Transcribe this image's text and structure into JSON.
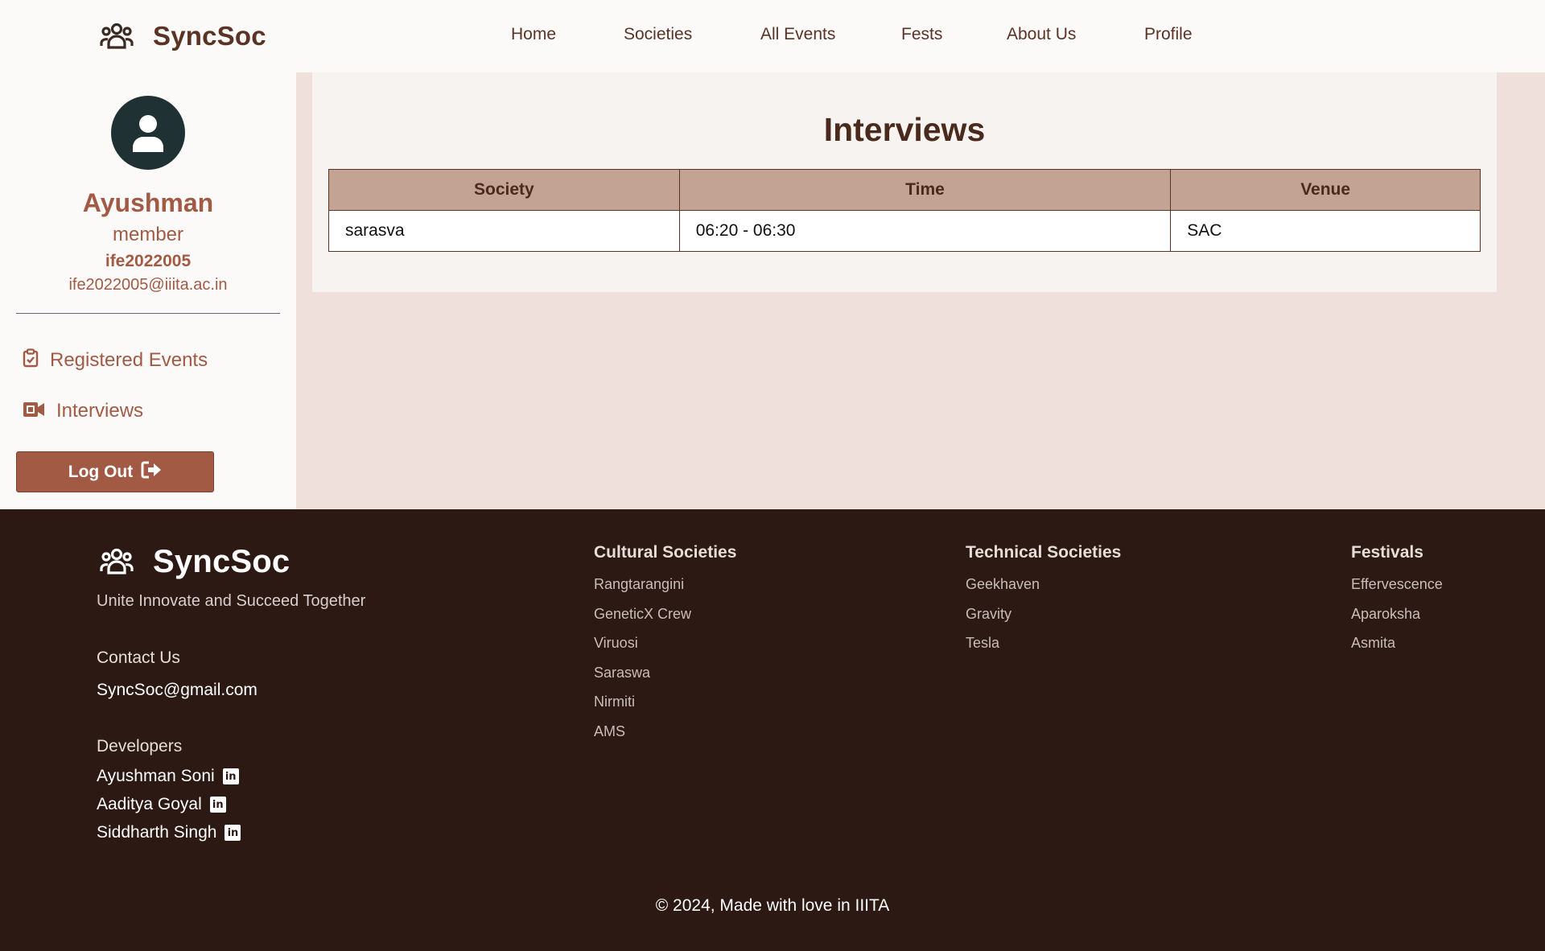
{
  "brand": {
    "name": "SyncSoc"
  },
  "nav": {
    "links": [
      "Home",
      "Societies",
      "All Events",
      "Fests",
      "About Us",
      "Profile"
    ]
  },
  "sidebar": {
    "user_name": "Ayushman",
    "role": "member",
    "user_id": "ife2022005",
    "email": "ife2022005@iiita.ac.in",
    "items": [
      {
        "label": "Registered Events",
        "icon": "clipboard-check-icon"
      },
      {
        "label": "Interviews",
        "icon": "video-camera-icon"
      }
    ],
    "logout_label": "Log Out"
  },
  "main": {
    "title": "Interviews",
    "table": {
      "headers": [
        "Society",
        "Time",
        "Venue"
      ],
      "rows": [
        [
          "sarasva",
          "06:20 - 06:30",
          "SAC"
        ]
      ]
    }
  },
  "footer": {
    "brand_name": "SyncSoc",
    "tagline": "Unite Innovate and Succeed Together",
    "contact_heading": "Contact Us",
    "contact_email": "SyncSoc@gmail.com",
    "developers_heading": "Developers",
    "developers": [
      "Ayushman Soni",
      "Aaditya Goyal",
      "Siddharth Singh"
    ],
    "columns": [
      {
        "heading": "Cultural Societies",
        "items": [
          "Rangtarangini",
          "GeneticX Crew",
          "Viruosi",
          "Saraswa",
          "Nirmiti",
          "AMS"
        ]
      },
      {
        "heading": "Technical Societies",
        "items": [
          "Geekhaven",
          "Gravity",
          "Tesla"
        ]
      },
      {
        "heading": "Festivals",
        "items": [
          "Effervescence",
          "Aparoksha",
          "Asmita"
        ]
      }
    ],
    "copyright": "© 2024, Made with love in IIITA"
  },
  "colors": {
    "accent": "#a25a44",
    "nav_text": "#5a3325",
    "footer_bg": "#2d1914",
    "page_bg": "#f0e0db",
    "table_header_bg": "#c3a393"
  }
}
